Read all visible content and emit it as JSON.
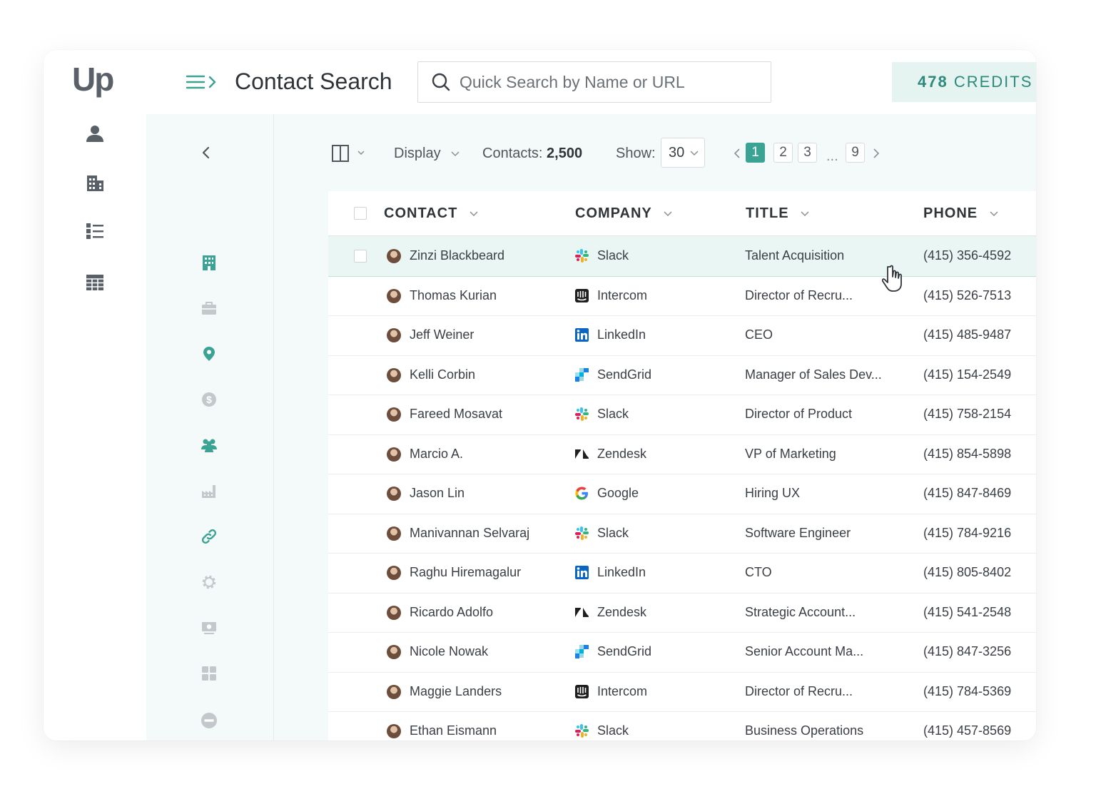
{
  "app": {
    "logo_text": "Up"
  },
  "header": {
    "title": "Contact Search",
    "search_placeholder": "Quick Search by Name or URL",
    "credits_count": "478",
    "credits_label": "CREDITS"
  },
  "toolbar": {
    "display_label": "Display",
    "contacts_label": "Contacts:",
    "contacts_count": "2,500",
    "show_label": "Show:",
    "show_value": "30",
    "pages": [
      "1",
      "2",
      "3",
      "...",
      "9"
    ],
    "current_page": "1"
  },
  "table": {
    "columns": [
      "CONTACT",
      "COMPANY",
      "TITLE",
      "PHONE"
    ],
    "rows": [
      {
        "name": "Zinzi Blackbeard",
        "company": "Slack",
        "company_icon": "slack-icon",
        "title": "Talent Acquisition",
        "phone": "(415) 356-4592"
      },
      {
        "name": "Thomas Kurian",
        "company": "Intercom",
        "company_icon": "intercom-icon",
        "title": "Director of Recru...",
        "phone": "(415) 526-7513"
      },
      {
        "name": "Jeff Weiner",
        "company": "LinkedIn",
        "company_icon": "linkedin-icon",
        "title": "CEO",
        "phone": "(415) 485-9487"
      },
      {
        "name": "Kelli Corbin",
        "company": "SendGrid",
        "company_icon": "sendgrid-icon",
        "title": "Manager of Sales Dev...",
        "phone": "(415) 154-2549"
      },
      {
        "name": "Fareed Mosavat",
        "company": "Slack",
        "company_icon": "slack-icon",
        "title": "Director of Product",
        "phone": "(415) 758-2154"
      },
      {
        "name": "Marcio A.",
        "company": "Zendesk",
        "company_icon": "zendesk-icon",
        "title": "VP of Marketing",
        "phone": "(415) 854-5898"
      },
      {
        "name": "Jason Lin",
        "company": "Google",
        "company_icon": "google-icon",
        "title": "Hiring UX",
        "phone": "(415) 847-8469"
      },
      {
        "name": "Manivannan Selvaraj",
        "company": "Slack",
        "company_icon": "slack-icon",
        "title": "Software Engineer",
        "phone": "(415) 784-9216"
      },
      {
        "name": "Raghu Hiremagalur",
        "company": "LinkedIn",
        "company_icon": "linkedin-icon",
        "title": "CTO",
        "phone": "(415) 805-8402"
      },
      {
        "name": "Ricardo Adolfo",
        "company": "Zendesk",
        "company_icon": "zendesk-icon",
        "title": "Strategic Account...",
        "phone": "(415) 541-2548"
      },
      {
        "name": "Nicole Nowak",
        "company": "SendGrid",
        "company_icon": "sendgrid-icon",
        "title": "Senior Account Ma...",
        "phone": "(415) 847-3256"
      },
      {
        "name": "Maggie Landers",
        "company": "Intercom",
        "company_icon": "intercom-icon",
        "title": "Director of Recru...",
        "phone": "(415) 784-5369"
      },
      {
        "name": "Ethan Eismann",
        "company": "Slack",
        "company_icon": "slack-icon",
        "title": "Business Operations",
        "phone": "(415) 457-8569"
      }
    ]
  },
  "colors": {
    "accent": "#3aa393",
    "accent_light": "#e6f4f1",
    "rail_icon": "#5a6068",
    "filter_inactive": "#c3c8cc"
  }
}
